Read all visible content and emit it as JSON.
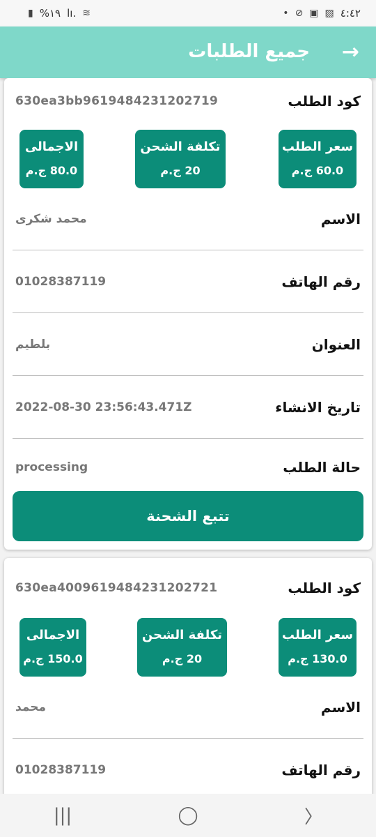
{
  "status_bar": {
    "time": "٤:٤٢",
    "battery": "%١٩",
    "signal": "lı.",
    "wifi_icon": "wifi-icon"
  },
  "app_bar": {
    "title": "جميع الطلبات",
    "back_icon": "→"
  },
  "labels": {
    "order_code": "كود الطلب",
    "order_price": "سعر الطلب",
    "shipping_cost": "تكلفة الشحن",
    "total": "الاجمالى",
    "name": "الاسم",
    "phone": "رقم الهاتف",
    "address": "العنوان",
    "created_at": "تاريخ الانشاء",
    "status": "حالة الطلب",
    "track_button": "تتبع الشحنة"
  },
  "orders": [
    {
      "code": "630ea3bb9619484231202719",
      "price": "60.0 ج.م",
      "shipping": "20 ج.م",
      "total": "80.0 ج.م",
      "name": "محمد شكرى",
      "phone": "01028387119",
      "address": "بلطيم",
      "created_at": "2022-08-30 23:56:43.471Z",
      "status": "processing"
    },
    {
      "code": "630ea4009619484231202721",
      "price": "130.0 ج.م",
      "shipping": "20 ج.م",
      "total": "150.0 ج.م",
      "name": "محمد",
      "phone": "01028387119"
    }
  ],
  "nav_bar": {
    "recents": "|||",
    "home": "◯",
    "back": "〉"
  }
}
